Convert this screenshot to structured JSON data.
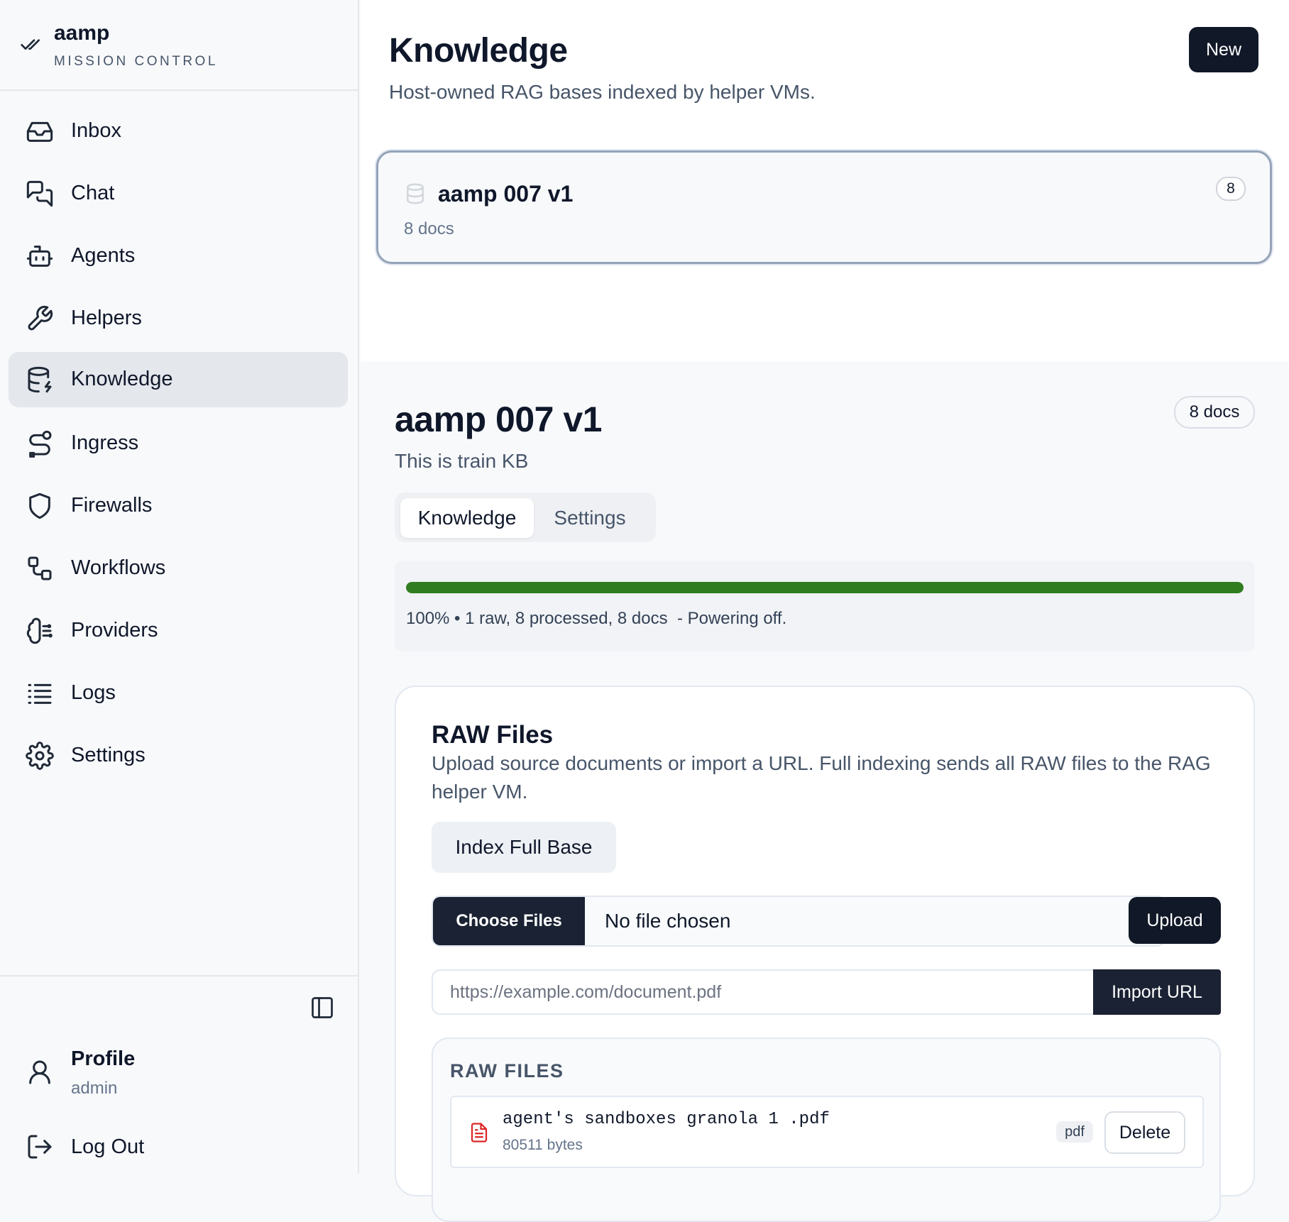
{
  "brand": {
    "name": "aamp",
    "subtitle": "MISSION CONTROL",
    "icon": "double-check-icon"
  },
  "sidebar": {
    "items": [
      {
        "label": "Inbox",
        "icon": "inbox-icon"
      },
      {
        "label": "Chat",
        "icon": "chat-icon"
      },
      {
        "label": "Agents",
        "icon": "bot-icon"
      },
      {
        "label": "Helpers",
        "icon": "wrench-icon"
      },
      {
        "label": "Knowledge",
        "icon": "database-icon",
        "active": true
      },
      {
        "label": "Ingress",
        "icon": "route-icon"
      },
      {
        "label": "Firewalls",
        "icon": "shield-icon"
      },
      {
        "label": "Workflows",
        "icon": "workflow-icon"
      },
      {
        "label": "Providers",
        "icon": "brain-icon"
      },
      {
        "label": "Logs",
        "icon": "list-icon"
      },
      {
        "label": "Settings",
        "icon": "gear-icon"
      }
    ],
    "profile": {
      "name": "Profile",
      "role": "admin"
    },
    "logout_label": "Log Out"
  },
  "header": {
    "title": "Knowledge",
    "subtitle": "Host-owned RAG bases indexed by helper VMs.",
    "new_label": "New"
  },
  "kb_list": [
    {
      "name": "aamp 007 v1",
      "docs": "8 docs",
      "count": "8"
    }
  ],
  "detail": {
    "title": "aamp 007 v1",
    "description": "This is train KB",
    "docs_badge": "8 docs",
    "tabs": [
      "Knowledge",
      "Settings"
    ],
    "active_tab": "Knowledge",
    "progress": {
      "percent": 100,
      "text": "100% • 1 raw, 8 processed, 8 docs  - Powering off.",
      "color": "#2f7d1f"
    }
  },
  "raw": {
    "title": "RAW Files",
    "description": "Upload source documents or import a URL. Full indexing sends all RAW files to the RAG helper VM.",
    "index_label": "Index Full Base",
    "choose_label": "Choose Files",
    "no_file": "No file chosen",
    "upload_label": "Upload",
    "url_placeholder": "https://example.com/document.pdf",
    "import_label": "Import URL",
    "list_header": "RAW FILES",
    "files": [
      {
        "name": "agent's sandboxes granola 1 .pdf",
        "size": "80511 bytes",
        "type": "pdf",
        "delete_label": "Delete"
      }
    ]
  },
  "colors": {
    "accent_dark": "#111827",
    "progress": "#2f7d1f",
    "active_nav": "#e4e7ec"
  }
}
